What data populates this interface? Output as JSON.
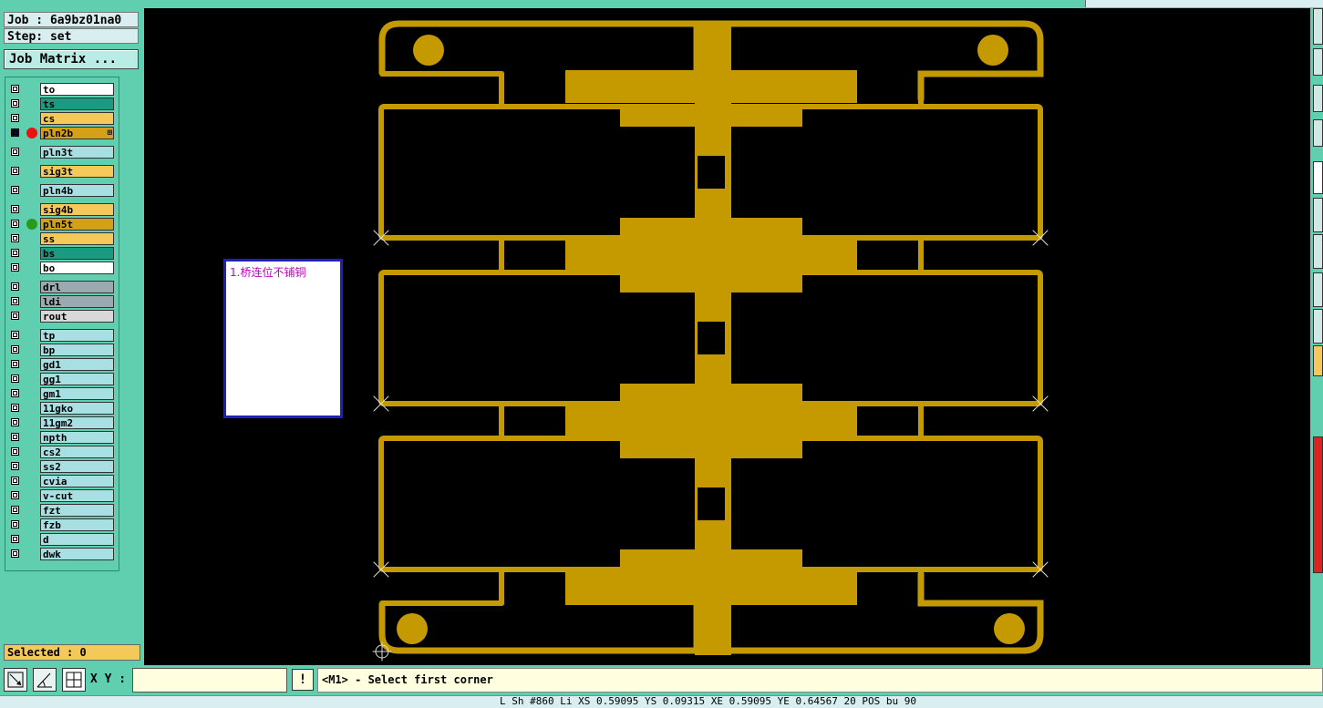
{
  "job": {
    "job_label": "Job : 6a9bz01na0",
    "step_label": "Step: set"
  },
  "buttons": {
    "job_matrix": "Job Matrix ..."
  },
  "layers": [
    {
      "name": "to",
      "color": "#ffffff",
      "active": false,
      "dot": ""
    },
    {
      "name": "ts",
      "color": "#1a9a80",
      "active": false,
      "dot": ""
    },
    {
      "name": "cs",
      "color": "#f5c85a",
      "active": false,
      "dot": ""
    },
    {
      "name": "pln2b",
      "color": "#d4a017",
      "active": true,
      "dot": "#ee1111",
      "marker": "⊞"
    },
    {
      "name": "pln3t",
      "color": "#a8dfe2",
      "active": false,
      "dot": ""
    },
    {
      "name": "sig3t",
      "color": "#f5c85a",
      "active": false,
      "dot": ""
    },
    {
      "name": "pln4b",
      "color": "#a8dfe2",
      "active": false,
      "dot": ""
    },
    {
      "name": "sig4b",
      "color": "#f5c85a",
      "active": false,
      "dot": ""
    },
    {
      "name": "pln5t",
      "color": "#d4a017",
      "active": false,
      "dot": "#2a9a1a"
    },
    {
      "name": "ss",
      "color": "#f5c85a",
      "active": false,
      "dot": ""
    },
    {
      "name": "bs",
      "color": "#1a9a80",
      "active": false,
      "dot": ""
    },
    {
      "name": "bo",
      "color": "#ffffff",
      "active": false,
      "dot": ""
    },
    {
      "name": "drl",
      "color": "#9aaab0",
      "active": false,
      "dot": ""
    },
    {
      "name": "ldi",
      "color": "#9aaab0",
      "active": false,
      "dot": ""
    },
    {
      "name": "rout",
      "color": "#d8d8d8",
      "active": false,
      "dot": ""
    },
    {
      "name": "tp",
      "color": "#a8dfe2",
      "active": false,
      "dot": ""
    },
    {
      "name": "bp",
      "color": "#a8dfe2",
      "active": false,
      "dot": ""
    },
    {
      "name": "gd1",
      "color": "#a8dfe2",
      "active": false,
      "dot": ""
    },
    {
      "name": "gg1",
      "color": "#a8dfe2",
      "active": false,
      "dot": ""
    },
    {
      "name": "gm1",
      "color": "#a8dfe2",
      "active": false,
      "dot": ""
    },
    {
      "name": "11gko",
      "color": "#a8dfe2",
      "active": false,
      "dot": ""
    },
    {
      "name": "11gm2",
      "color": "#a8dfe2",
      "active": false,
      "dot": ""
    },
    {
      "name": "npth",
      "color": "#a8dfe2",
      "active": false,
      "dot": ""
    },
    {
      "name": "cs2",
      "color": "#a8dfe2",
      "active": false,
      "dot": ""
    },
    {
      "name": "ss2",
      "color": "#a8dfe2",
      "active": false,
      "dot": ""
    },
    {
      "name": "cvia",
      "color": "#a8dfe2",
      "active": false,
      "dot": ""
    },
    {
      "name": "v-cut",
      "color": "#a8dfe2",
      "active": false,
      "dot": ""
    },
    {
      "name": "fzt",
      "color": "#a8dfe2",
      "active": false,
      "dot": ""
    },
    {
      "name": "fzb",
      "color": "#a8dfe2",
      "active": false,
      "dot": ""
    },
    {
      "name": "d",
      "color": "#a8dfe2",
      "active": false,
      "dot": ""
    },
    {
      "name": "dwk",
      "color": "#a8dfe2",
      "active": false,
      "dot": ""
    }
  ],
  "selected": "Selected : 0",
  "note": {
    "text": "1.桥连位不铺铜"
  },
  "toolbar": {
    "xy_label": "X Y :",
    "xy_value": "",
    "warn_label": "!"
  },
  "prompt": "<M1> - Select first corner",
  "status": "L  Sh  #860  Li  XS  0.59095  YS  0.09315  XE  0.59095  YE  0.64567  20  POS  bu  90",
  "theme": {
    "copper": "#c49a00",
    "canvas_bg": "#000000",
    "panel_bg": "#5fcfb0"
  }
}
